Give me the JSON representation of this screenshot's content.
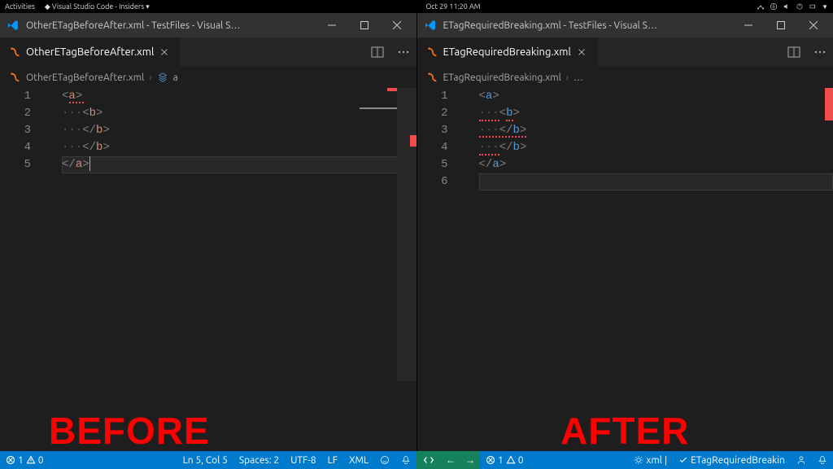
{
  "topbar": {
    "activities": "Activities",
    "app": "Visual Studio Code - Insiders",
    "datetime": "Oct 29  11:20 AM"
  },
  "left": {
    "title": "OtherETagBeforeAfter.xml - TestFiles - Visual S…",
    "tab": "OtherETagBeforeAfter.xml",
    "breadcrumb_file": "OtherETagBeforeAfter.xml",
    "breadcrumb_symbol": "a",
    "lines": [
      "1",
      "2",
      "3",
      "4",
      "5"
    ],
    "label": "BEFORE"
  },
  "right": {
    "title": "ETagRequiredBreaking.xml - TestFiles - Visual S…",
    "tab": "ETagRequiredBreaking.xml",
    "breadcrumb_file": "ETagRequiredBreaking.xml",
    "breadcrumb_symbol": "…",
    "lines": [
      "1",
      "2",
      "3",
      "4",
      "5",
      "6"
    ],
    "label": "AFTER"
  },
  "code_left": {
    "l1_p1": "<",
    "l1_tag": "a",
    "l1_p2": ">",
    "l2_ind": "···",
    "l2_p1": "<",
    "l2_tag": "b",
    "l2_p2": ">",
    "l3_ind": "···",
    "l3_p1": "</",
    "l3_tag": "b",
    "l3_p2": ">",
    "l4_ind": "···",
    "l4_p1": "</",
    "l4_tag": "b",
    "l4_p2": ">",
    "l5_p1": "</",
    "l5_tag": "a",
    "l5_p2": ">"
  },
  "code_right": {
    "l1_p1": "<",
    "l1_tag": "a",
    "l1_p2": ">",
    "l2_ind": "···",
    "l2_p1": "<",
    "l2_tag": "b",
    "l2_p2": ">",
    "l3_ind": "···",
    "l3_p1": "</",
    "l3_tag": "b",
    "l3_p2": ">",
    "l4_ind": "···",
    "l4_p1": "</",
    "l4_tag": "b",
    "l4_p2": ">",
    "l5_p1": "</",
    "l5_tag": "a",
    "l5_p2": ">"
  },
  "statusbar": {
    "left": {
      "errors": "1",
      "warnings": "0",
      "cursor": "Ln 5, Col 5",
      "spaces": "Spaces: 2",
      "encoding": "UTF-8",
      "eol": "LF",
      "lang": "XML"
    },
    "right": {
      "errors": "1",
      "warnings": "0",
      "lang": "xml",
      "task": "ETagRequiredBreakin"
    }
  }
}
